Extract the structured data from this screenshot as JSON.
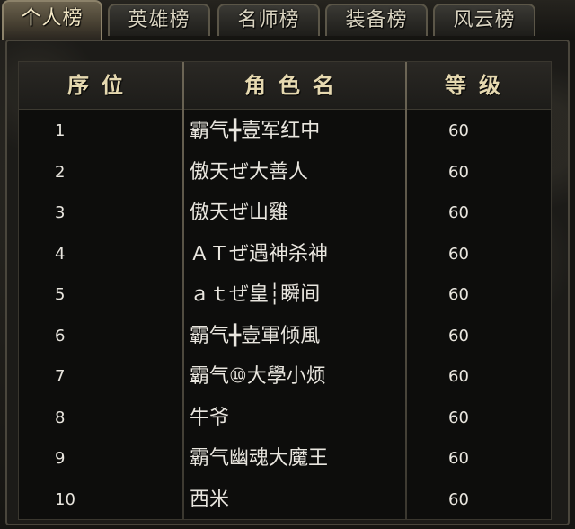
{
  "tabs": [
    {
      "label": "个人榜",
      "active": true
    },
    {
      "label": "英雄榜",
      "active": false
    },
    {
      "label": "名师榜",
      "active": false
    },
    {
      "label": "装备榜",
      "active": false
    },
    {
      "label": "风云榜",
      "active": false
    }
  ],
  "headers": {
    "rank": "序位",
    "name": "角色名",
    "level": "等级"
  },
  "rows": [
    {
      "rank": "1",
      "name": "霸气╋壹军红中",
      "level": "60"
    },
    {
      "rank": "2",
      "name": "傲天ぜ大善人",
      "level": "60"
    },
    {
      "rank": "3",
      "name": "傲天ぜ山雞",
      "level": "60"
    },
    {
      "rank": "4",
      "name": "ＡＴぜ遇神杀神",
      "level": "60"
    },
    {
      "rank": "5",
      "name": "ａｔぜ皇┆瞬间",
      "level": "60"
    },
    {
      "rank": "6",
      "name": "霸气╋壹軍倾風",
      "level": "60"
    },
    {
      "rank": "7",
      "name": "霸气⑩大學小烦",
      "level": "60"
    },
    {
      "rank": "8",
      "name": "牛爷",
      "level": "60"
    },
    {
      "rank": "9",
      "name": "霸气幽魂大魔王",
      "level": "60"
    },
    {
      "rank": "10",
      "name": "西米",
      "level": "60"
    }
  ]
}
